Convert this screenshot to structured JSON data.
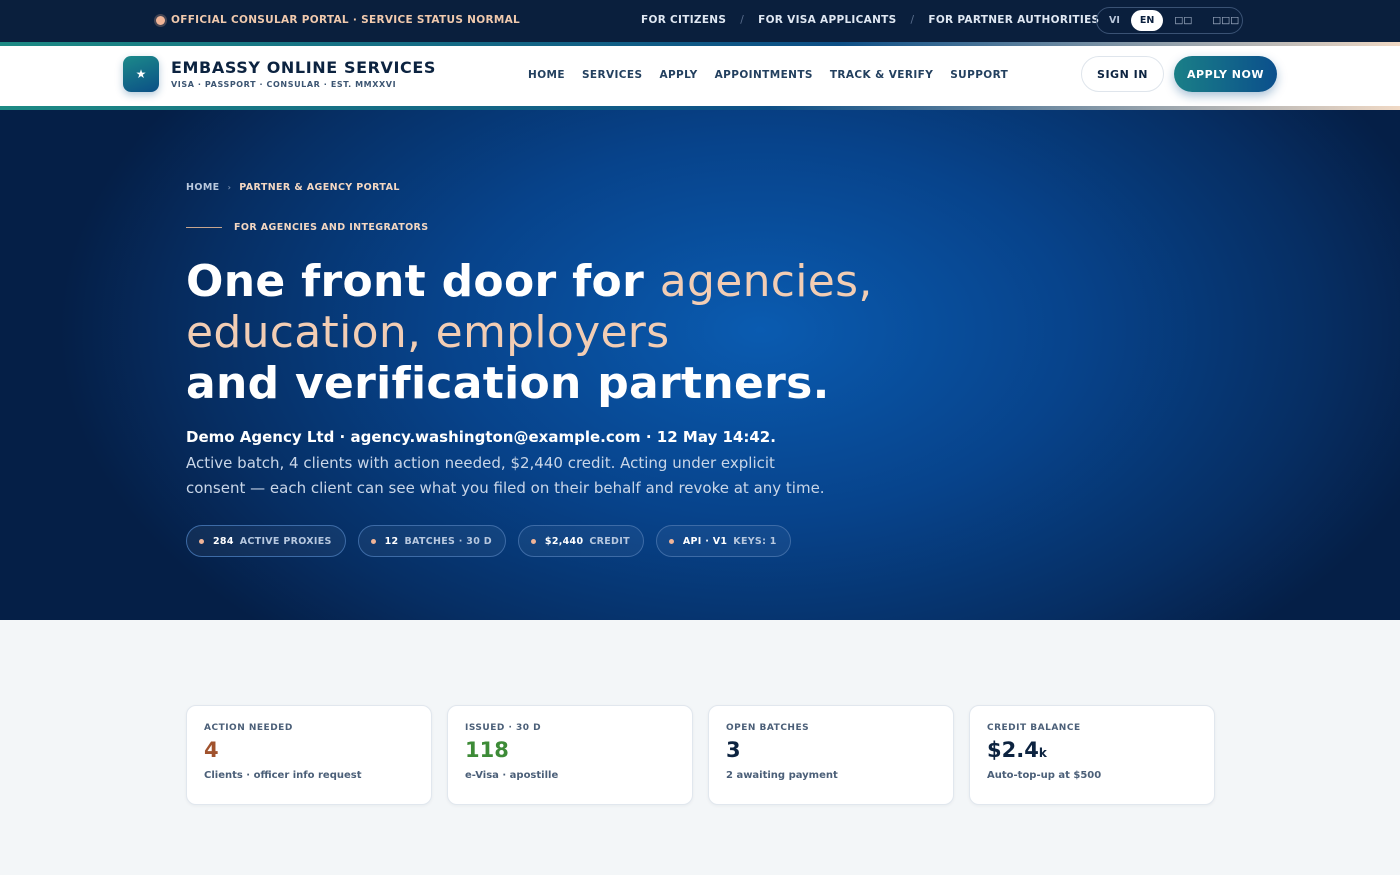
{
  "topbar": {
    "status": "OFFICIAL CONSULAR PORTAL · SERVICE STATUS NORMAL",
    "audiences": [
      "FOR CITIZENS",
      "FOR VISA APPLICANTS",
      "FOR PARTNER AUTHORITIES"
    ],
    "audience_separator": "/",
    "languages": [
      "VI",
      "EN",
      "□□",
      "□□□"
    ],
    "active_language": "EN"
  },
  "header": {
    "logo_icon": "star",
    "brand_title": "EMBASSY ONLINE SERVICES",
    "brand_subtitle": "VISA · PASSPORT · CONSULAR · EST. MMXXVI",
    "nav": [
      "HOME",
      "SERVICES",
      "APPLY",
      "APPOINTMENTS",
      "TRACK & VERIFY",
      "SUPPORT"
    ],
    "signin_label": "SIGN IN",
    "apply_label": "APPLY NOW"
  },
  "hero": {
    "breadcrumb": {
      "home": "HOME",
      "separator": "›",
      "current": "PARTNER & AGENCY PORTAL"
    },
    "eyebrow": "FOR AGENCIES AND INTEGRATORS",
    "headline": {
      "part1": "One front door for ",
      "accent1": "agencies,",
      "accent2": "education, employers",
      "part2": "and verification partners."
    },
    "lead_strong": "Demo Agency Ltd · agency.washington@example.com · 12 May 14:42.",
    "lead_text": " Active batch, 4 clients with action needed, $2,440 credit. Acting under explicit consent — each client can see what you filed on their behalf and revoke at any time.",
    "chips": [
      {
        "value": "284",
        "label": "ACTIVE PROXIES"
      },
      {
        "value": "12",
        "label": "BATCHES · 30 D"
      },
      {
        "value": "$2,440",
        "label": "CREDIT"
      },
      {
        "value": "API · V1",
        "label": "KEYS: 1"
      }
    ]
  },
  "stats": [
    {
      "label": "ACTION NEEDED",
      "value": "4",
      "unit": "",
      "sub": "Clients · officer info request",
      "color": "#a0522d"
    },
    {
      "label": "ISSUED · 30 D",
      "value": "118",
      "unit": "",
      "sub": "e-Visa · apostille",
      "color": "#3d8b37"
    },
    {
      "label": "OPEN BATCHES",
      "value": "3",
      "unit": "",
      "sub": "2 awaiting payment",
      "color": "#0c2340"
    },
    {
      "label": "CREDIT BALANCE",
      "value": "$2.4",
      "unit": "k",
      "sub": "Auto-top-up at $500",
      "color": "#0c2340"
    }
  ],
  "colors": {
    "navy": "#0a1f3d",
    "hero_blue": "#07438b",
    "accent_peach": "#f2cdb4",
    "teal": "#1a7f87"
  }
}
